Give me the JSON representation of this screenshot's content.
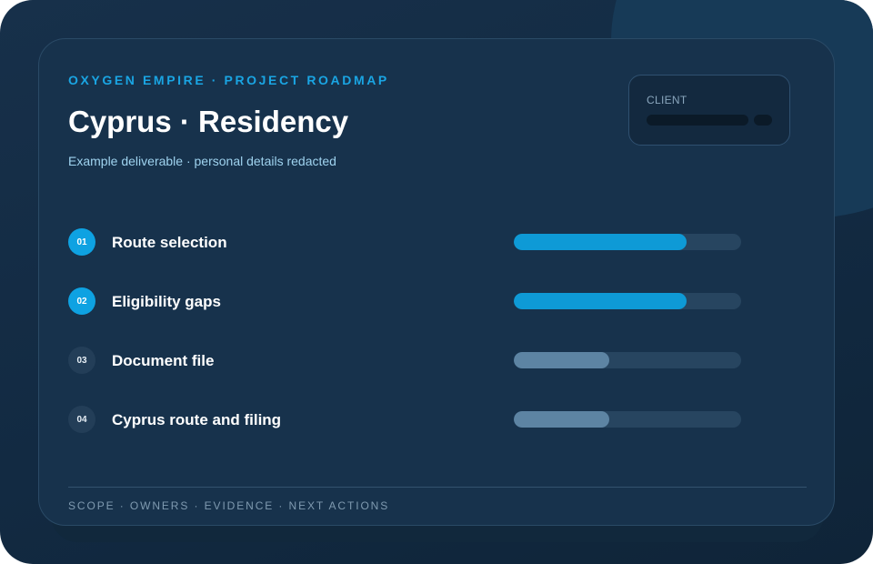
{
  "header": {
    "eyebrow": "OXYGEN EMPIRE · PROJECT ROADMAP",
    "title": "Cyprus · Residency",
    "subtitle": "Example deliverable · personal details redacted"
  },
  "client": {
    "label": "CLIENT"
  },
  "steps": [
    {
      "number": "01",
      "label": "Route selection",
      "progress": 0.76,
      "status": "active"
    },
    {
      "number": "02",
      "label": "Eligibility gaps",
      "progress": 0.76,
      "status": "active"
    },
    {
      "number": "03",
      "label": "Document file",
      "progress": 0.42,
      "status": "pending"
    },
    {
      "number": "04",
      "label": "Cyprus route and filing",
      "progress": 0.42,
      "status": "pending"
    }
  ],
  "footer": {
    "text": "SCOPE · OWNERS · EVIDENCE · NEXT ACTIONS"
  },
  "colors": {
    "accent": "#0ea2e2",
    "background": "#17324c",
    "pending_fill": "#5d84a3"
  }
}
